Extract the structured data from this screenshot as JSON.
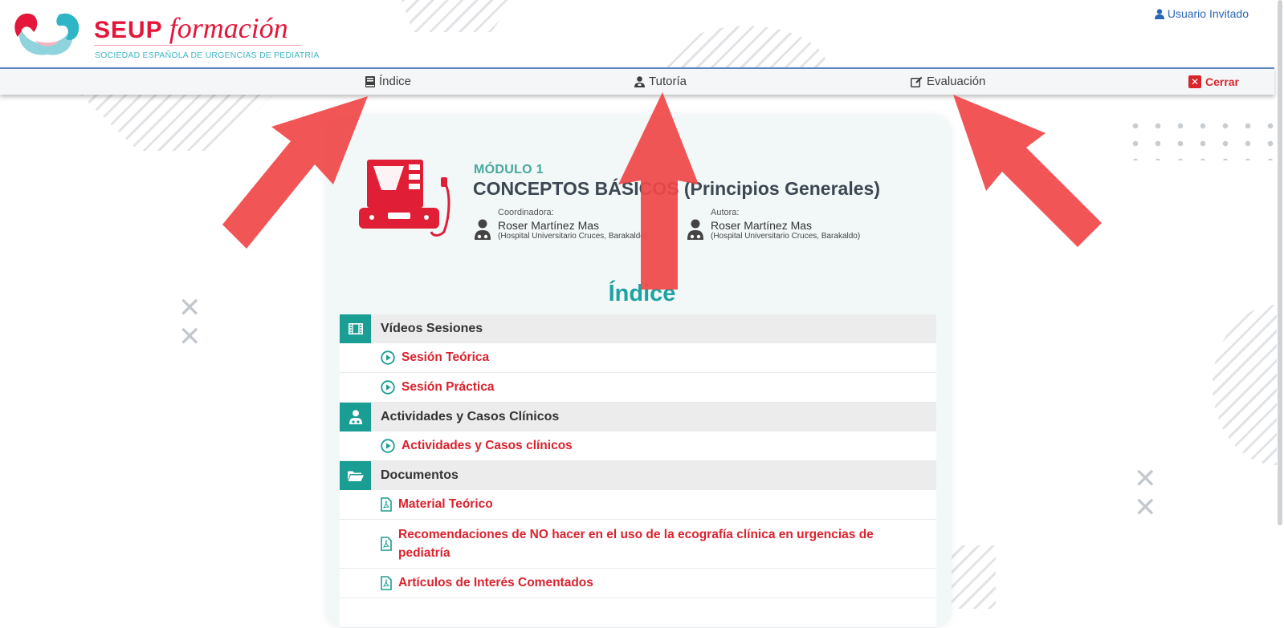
{
  "header": {
    "logo_main": "SEUP",
    "logo_script": "formación",
    "logo_subtitle": "SOCIEDAD ESPAÑOLA DE URGENCIAS DE PEDIATRIA",
    "user_label": "Usuario Invitado"
  },
  "nav": {
    "indice": "Índice",
    "tutoria": "Tutoría",
    "evaluacion": "Evaluación",
    "cerrar": "Cerrar"
  },
  "module": {
    "kicker": "MÓDULO 1",
    "title": "CONCEPTOS BÁSICOS (Principios Generales)",
    "coordinator": {
      "role": "Coordinadora:",
      "name": "Roser Martínez Mas",
      "hospital": "(Hospital Universitario Cruces, Barakaldo)"
    },
    "author": {
      "role": "Autora:",
      "name": "Roser Martínez Mas",
      "hospital": "(Hospital Universitario Cruces, Barakaldo)"
    }
  },
  "index": {
    "title": "Índice",
    "sections": [
      {
        "label": "Vídeos Sesiones",
        "icon": "film-icon",
        "items": [
          {
            "label": "Sesión Teórica",
            "icon": "play-circle-icon"
          },
          {
            "label": "Sesión Práctica",
            "icon": "play-circle-icon"
          }
        ]
      },
      {
        "label": "Actividades y Casos Clínicos",
        "icon": "doctor-icon",
        "items": [
          {
            "label": "Actividades y Casos clínicos",
            "icon": "play-circle-icon"
          }
        ]
      },
      {
        "label": "Documentos",
        "icon": "folder-open-icon",
        "items": [
          {
            "label": "Material Teórico",
            "icon": "pdf-file-icon"
          },
          {
            "label": "Recomendaciones de NO hacer en el uso de la ecografía clínica en urgencias de pediatría",
            "icon": "pdf-file-icon"
          },
          {
            "label": "Artículos de Interés Comentados",
            "icon": "pdf-file-icon"
          }
        ]
      }
    ]
  },
  "colors": {
    "brand_red": "#e4163a",
    "teal": "#1a9d92",
    "link_red": "#d9232e",
    "arrow_red": "#f04848"
  }
}
